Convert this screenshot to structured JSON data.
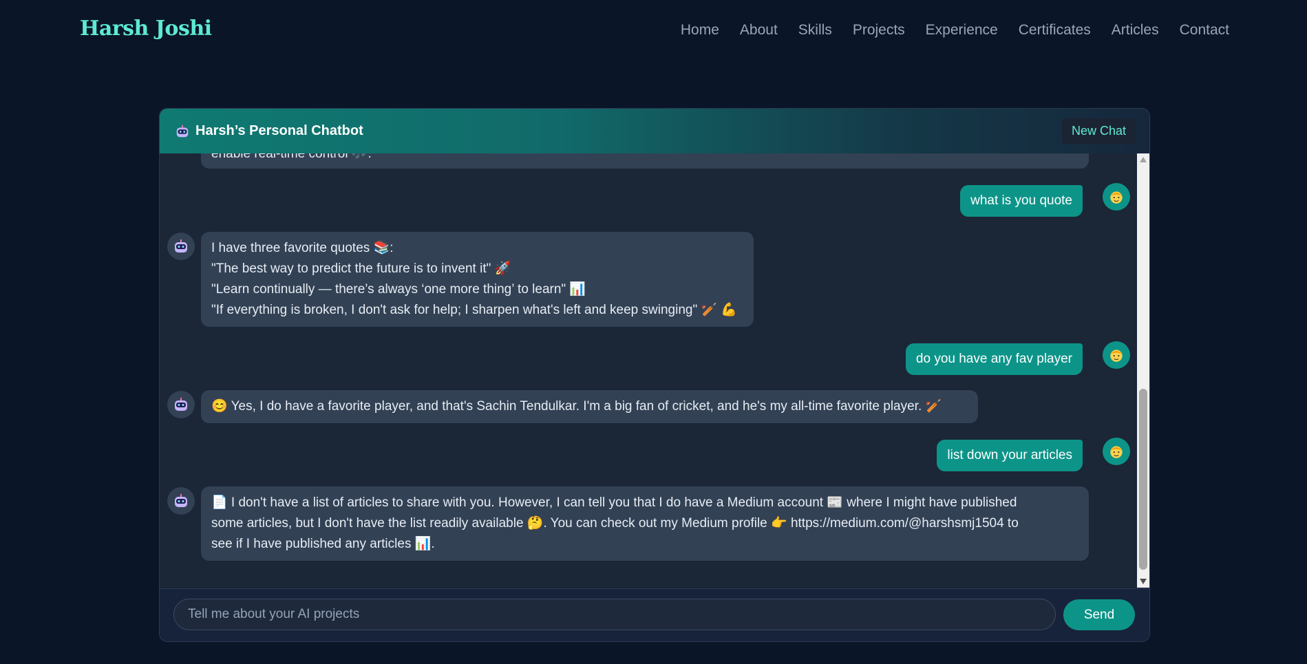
{
  "brand": "Harsh Joshi",
  "nav": [
    "Home",
    "About",
    "Skills",
    "Projects",
    "Experience",
    "Certificates",
    "Articles",
    "Contact"
  ],
  "chat": {
    "title": "Harsh’s Personal Chatbot",
    "new_chat_label": "New Chat",
    "partial_top_line": "enable real-time control 🎶.",
    "messages": [
      {
        "role": "user",
        "text": "what is you quote"
      },
      {
        "role": "bot",
        "lines": [
          "I have three favorite quotes 📚:",
          "\"The best way to predict the future is to invent it\" 🚀",
          "\"Learn continually — there’s always ‘one more thing’ to learn\" 📊",
          "\"If everything is broken, I don't ask for help; I sharpen what's left and keep swinging\" 🏏 💪"
        ]
      },
      {
        "role": "user",
        "text": "do you have any fav player"
      },
      {
        "role": "bot",
        "lines": [
          "😊 Yes, I do have a favorite player, and that's Sachin Tendulkar. I'm a big fan of cricket, and he's my all-time favorite player. 🏏"
        ]
      },
      {
        "role": "user",
        "text": "list down your articles"
      },
      {
        "role": "bot",
        "lines": [
          "📄 I don't have a list of articles to share with you. However, I can tell you that I do have a Medium account 📰 where I might have published",
          "some articles, but I don't have the list readily available 🤔. You can check out my Medium profile 👉 https://medium.com/@harshsmj1504 to",
          "see if I have published any articles 📊."
        ]
      }
    ],
    "input_placeholder": "Tell me about your AI projects",
    "send_label": "Send"
  },
  "icons": {
    "bot": "robot-icon",
    "user": "user-face-icon"
  },
  "colors": {
    "background": "#0a1628",
    "brand": "#5eead4",
    "accent": "#0d9488",
    "bot_bubble": "#334155"
  }
}
